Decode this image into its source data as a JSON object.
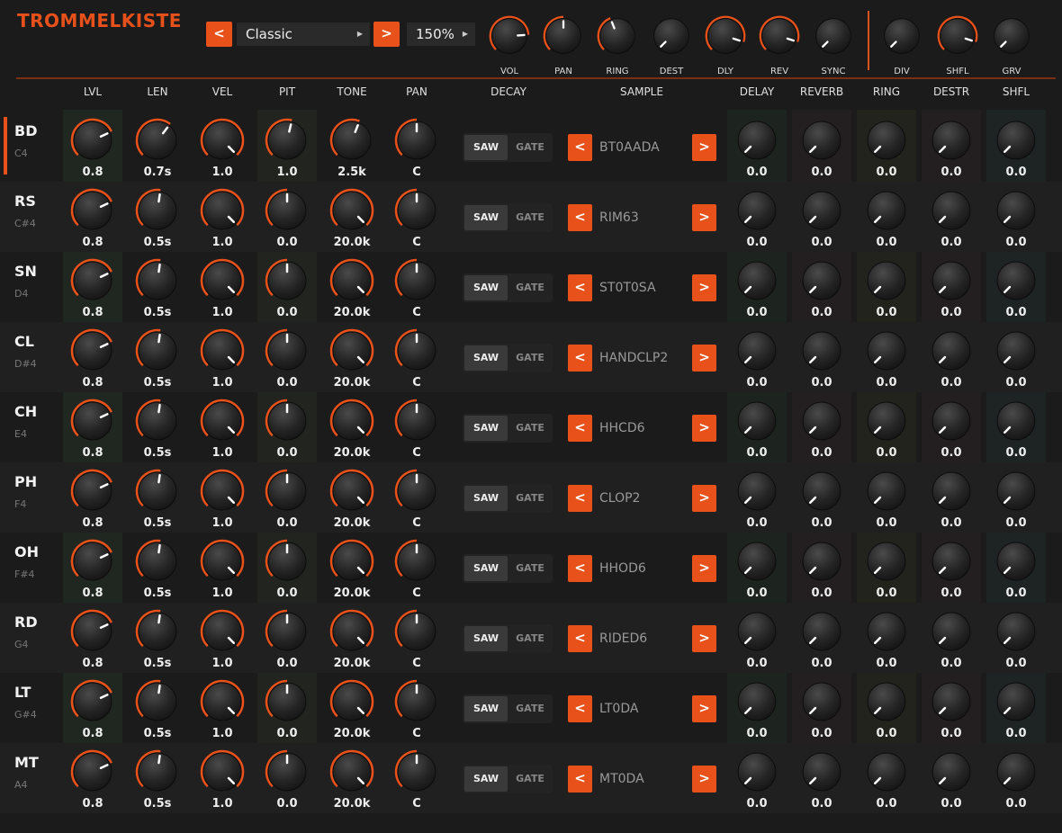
{
  "app": {
    "title": "TROMMELKISTE"
  },
  "header": {
    "preset": "Classic",
    "prev_label": "<",
    "next_label": ">",
    "zoom": "150%",
    "knobs": [
      {
        "label": "VOL",
        "value": 0.82
      },
      {
        "label": "PAN",
        "value": 0.5
      },
      {
        "label": "RING",
        "value": 0.42
      },
      {
        "label": "DEST",
        "value": 0.0
      },
      {
        "label": "DLY",
        "value": 0.9
      },
      {
        "label": "REV",
        "value": 0.9
      },
      {
        "label": "SYNC",
        "value": 0.0
      },
      {
        "label": "DIV",
        "value": 0.0
      },
      {
        "label": "SHFL",
        "value": 0.9
      },
      {
        "label": "GRV",
        "value": 0.0
      }
    ]
  },
  "columns": [
    "LVL",
    "LEN",
    "VEL",
    "PIT",
    "TONE",
    "PAN",
    "DECAY",
    "SAMPLE",
    "DELAY",
    "REVERB",
    "RING",
    "DESTR",
    "SHFL"
  ],
  "decay_options": {
    "saw": "SAW",
    "gate": "GATE"
  },
  "colors": {
    "accent": "#e8521a",
    "background": "#1b1b1b"
  },
  "tracks": [
    {
      "name": "BD",
      "note": "C4",
      "selected": true,
      "lvl": "0.8",
      "len": "0.7s",
      "vel": "1.0",
      "pit": "1.0",
      "tone": "2.5k",
      "pan": "C",
      "sample": "BT0AADA",
      "fx": [
        "0.0",
        "0.0",
        "0.0",
        "0.0",
        "0.0"
      ],
      "lvl_v": 0.74,
      "len_v": 0.64,
      "vel_v": 1.0,
      "pit_v": 0.55,
      "tone_v": 0.58,
      "pan_v": 0.5
    },
    {
      "name": "RS",
      "note": "C#4",
      "lvl": "0.8",
      "len": "0.5s",
      "vel": "1.0",
      "pit": "0.0",
      "tone": "20.0k",
      "pan": "C",
      "sample": "RIM63",
      "fx": [
        "0.0",
        "0.0",
        "0.0",
        "0.0",
        "0.0"
      ],
      "lvl_v": 0.74,
      "len_v": 0.53,
      "vel_v": 1.0,
      "pit_v": 0.5,
      "tone_v": 1.0,
      "pan_v": 0.5
    },
    {
      "name": "SN",
      "note": "D4",
      "lvl": "0.8",
      "len": "0.5s",
      "vel": "1.0",
      "pit": "0.0",
      "tone": "20.0k",
      "pan": "C",
      "sample": "ST0T0SA",
      "fx": [
        "0.0",
        "0.0",
        "0.0",
        "0.0",
        "0.0"
      ],
      "lvl_v": 0.74,
      "len_v": 0.53,
      "vel_v": 1.0,
      "pit_v": 0.5,
      "tone_v": 1.0,
      "pan_v": 0.5
    },
    {
      "name": "CL",
      "note": "D#4",
      "lvl": "0.8",
      "len": "0.5s",
      "vel": "1.0",
      "pit": "0.0",
      "tone": "20.0k",
      "pan": "C",
      "sample": "HANDCLP2",
      "fx": [
        "0.0",
        "0.0",
        "0.0",
        "0.0",
        "0.0"
      ],
      "lvl_v": 0.74,
      "len_v": 0.53,
      "vel_v": 1.0,
      "pit_v": 0.5,
      "tone_v": 1.0,
      "pan_v": 0.5
    },
    {
      "name": "CH",
      "note": "E4",
      "lvl": "0.8",
      "len": "0.5s",
      "vel": "1.0",
      "pit": "0.0",
      "tone": "20.0k",
      "pan": "C",
      "sample": "HHCD6",
      "fx": [
        "0.0",
        "0.0",
        "0.0",
        "0.0",
        "0.0"
      ],
      "lvl_v": 0.74,
      "len_v": 0.53,
      "vel_v": 1.0,
      "pit_v": 0.5,
      "tone_v": 1.0,
      "pan_v": 0.5
    },
    {
      "name": "PH",
      "note": "F4",
      "lvl": "0.8",
      "len": "0.5s",
      "vel": "1.0",
      "pit": "0.0",
      "tone": "20.0k",
      "pan": "C",
      "sample": "CLOP2",
      "fx": [
        "0.0",
        "0.0",
        "0.0",
        "0.0",
        "0.0"
      ],
      "lvl_v": 0.74,
      "len_v": 0.53,
      "vel_v": 1.0,
      "pit_v": 0.5,
      "tone_v": 1.0,
      "pan_v": 0.5
    },
    {
      "name": "OH",
      "note": "F#4",
      "lvl": "0.8",
      "len": "0.5s",
      "vel": "1.0",
      "pit": "0.0",
      "tone": "20.0k",
      "pan": "C",
      "sample": "HHOD6",
      "fx": [
        "0.0",
        "0.0",
        "0.0",
        "0.0",
        "0.0"
      ],
      "lvl_v": 0.74,
      "len_v": 0.53,
      "vel_v": 1.0,
      "pit_v": 0.5,
      "tone_v": 1.0,
      "pan_v": 0.5
    },
    {
      "name": "RD",
      "note": "G4",
      "lvl": "0.8",
      "len": "0.5s",
      "vel": "1.0",
      "pit": "0.0",
      "tone": "20.0k",
      "pan": "C",
      "sample": "RIDED6",
      "fx": [
        "0.0",
        "0.0",
        "0.0",
        "0.0",
        "0.0"
      ],
      "lvl_v": 0.74,
      "len_v": 0.53,
      "vel_v": 1.0,
      "pit_v": 0.5,
      "tone_v": 1.0,
      "pan_v": 0.5
    },
    {
      "name": "LT",
      "note": "G#4",
      "lvl": "0.8",
      "len": "0.5s",
      "vel": "1.0",
      "pit": "0.0",
      "tone": "20.0k",
      "pan": "C",
      "sample": "LT0DA",
      "fx": [
        "0.0",
        "0.0",
        "0.0",
        "0.0",
        "0.0"
      ],
      "lvl_v": 0.74,
      "len_v": 0.53,
      "vel_v": 1.0,
      "pit_v": 0.5,
      "tone_v": 1.0,
      "pan_v": 0.5
    },
    {
      "name": "MT",
      "note": "A4",
      "lvl": "0.8",
      "len": "0.5s",
      "vel": "1.0",
      "pit": "0.0",
      "tone": "20.0k",
      "pan": "C",
      "sample": "MT0DA",
      "fx": [
        "0.0",
        "0.0",
        "0.0",
        "0.0",
        "0.0"
      ],
      "lvl_v": 0.74,
      "len_v": 0.53,
      "vel_v": 1.0,
      "pit_v": 0.5,
      "tone_v": 1.0,
      "pan_v": 0.5
    }
  ]
}
